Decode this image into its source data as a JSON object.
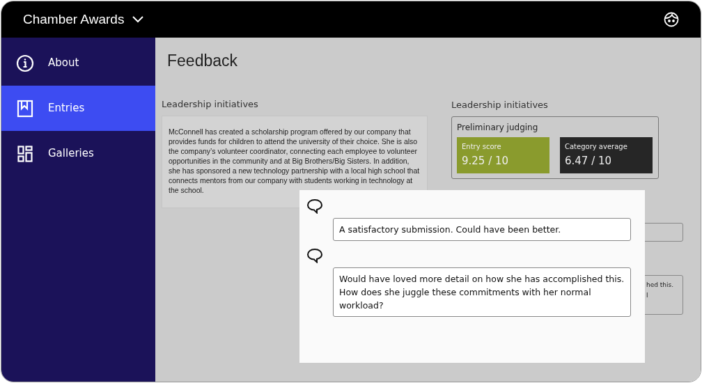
{
  "app_bar": {
    "title": "Chamber Awards"
  },
  "sidebar": {
    "items": [
      {
        "kind": "info",
        "label": "About",
        "selected": false
      },
      {
        "kind": "bookmark",
        "label": "Entries",
        "selected": true
      },
      {
        "kind": "grid",
        "label": "Galleries",
        "selected": false
      }
    ]
  },
  "page": {
    "title": "Feedback",
    "entry": {
      "label": "Leadership initiatives",
      "text": "McConnell has created a scholarship program offered by our company that provides funds for children to attend the university of their choice. She is also the company’s volunteer coordinator, connecting each employee to volunteer opportunities in the community and at Big Brothers/Big Sisters. In addition, she has sponsored a new technology partnership with a local high school that connects mentors from our company with students working in technology at the school."
    },
    "judging": {
      "label": "Leadership initiatives",
      "title": "Preliminary judging",
      "scores": [
        {
          "kind": "entry",
          "label": "Entry score",
          "value": "9.25 / 10"
        },
        {
          "kind": "average",
          "label": "Category average",
          "value": "6.47 / 10"
        }
      ]
    },
    "background_fields": [
      {
        "kind": "single_line"
      },
      {
        "kind": "multi_line",
        "lines": [
          "hed this.",
          "l"
        ]
      }
    ]
  },
  "comments_popup": {
    "comments": [
      {
        "text": "A satisfactory submission. Could have been better."
      },
      {
        "text": "Would have loved more detail on how she has accomplished this. How does she juggle these commitments with her normal workload?"
      }
    ]
  }
}
